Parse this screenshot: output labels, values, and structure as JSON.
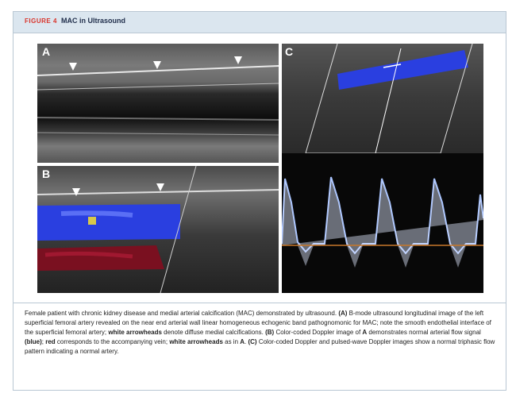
{
  "figure": {
    "number": "FIGURE 4",
    "title": "MAC in Ultrasound"
  },
  "panels": {
    "a": {
      "label": "A"
    },
    "b": {
      "label": "B"
    },
    "c": {
      "label": "C"
    }
  },
  "caption": {
    "part1": "Female patient with chronic kidney disease and medial arterial calcification (MAC) demonstrated by ultrasound. ",
    "a_label": "(A)",
    "part2": " B-mode ultrasound longitudinal image of the left superficial femoral artery revealed on the near end arterial wall linear homogeneous echogenic band pathognomonic for MAC; note the smooth endothelial interface of the superficial femoral artery; ",
    "white_arrowheads_1": "white arrowheads",
    "part3": " denote diffuse medial calcifications. ",
    "b_label": "(B)",
    "part4": " Color-coded Doppler image of ",
    "a_ref": "A",
    "part5": " demonstrates normal arterial flow signal ",
    "blue": "(blue)",
    "part6": "; ",
    "red": "red",
    "part7": " corresponds to the accompanying vein; ",
    "white_arrowheads_2": "white arrowheads",
    "part8": " as in ",
    "a_ref2": "A",
    "part9": ". ",
    "c_label": "(C)",
    "part10": " Color-coded Doppler and pulsed-wave Doppler images show a normal triphasic flow pattern indicating a normal artery."
  },
  "colors": {
    "figure_number": "#d9342b",
    "header_bg": "#dbe6ef",
    "doppler_artery": "#2a3fe0",
    "doppler_vein": "#8a1020",
    "waveform": "#a9c4ff",
    "baseline": "#c8782a"
  }
}
